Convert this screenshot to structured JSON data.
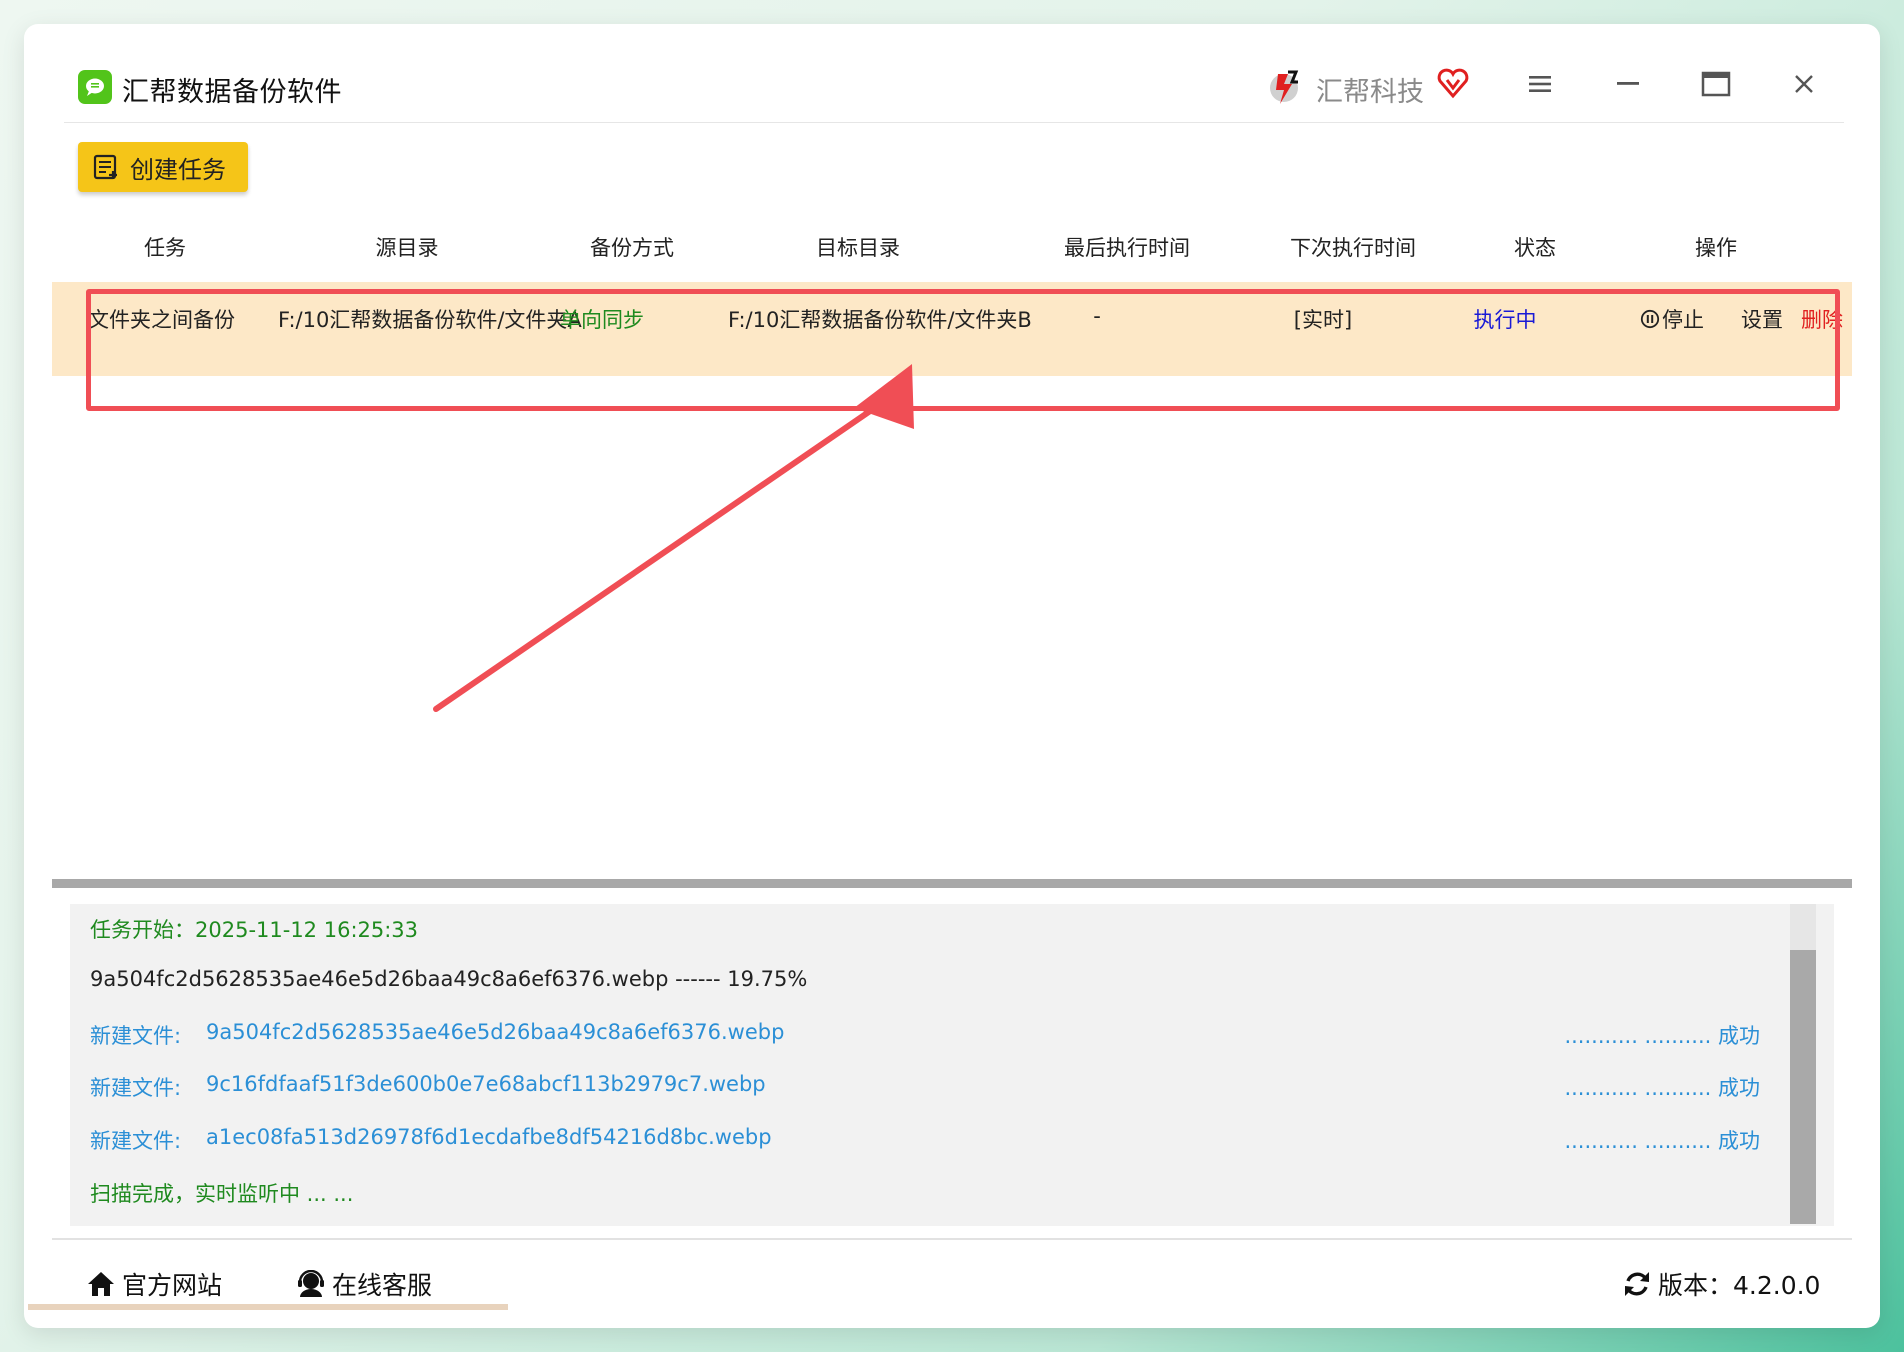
{
  "app": {
    "title": "汇帮数据备份软件",
    "brand_name": "汇帮科技",
    "icons": [
      "chat-app-icon",
      "brand-logo-icon",
      "vip-heart-icon",
      "menu-icon",
      "minimize-icon",
      "maximize-icon",
      "close-icon"
    ]
  },
  "toolbar": {
    "create_task_label": "创建任务"
  },
  "table": {
    "headers": [
      "任务",
      "源目录",
      "备份方式",
      "目标目录",
      "最后执行时间",
      "下次执行时间",
      "状态",
      "操作"
    ],
    "rows": [
      {
        "task": "文件夹之间备份",
        "source": "F:/10汇帮数据备份软件/文件夹A",
        "method": "单向同步",
        "target": "F:/10汇帮数据备份软件/文件夹B",
        "last_run": "-",
        "next_run": "[实时]",
        "status": "执行中",
        "actions": {
          "stop": "停止",
          "settings": "设置",
          "delete": "删除"
        }
      }
    ]
  },
  "log": {
    "start": "任务开始：2025-11-12 16:25:33",
    "progress": "9a504fc2d5628535ae46e5d26baa49c8a6ef6376.webp ------ 19.75%",
    "entries": [
      {
        "prefix": "新建文件:",
        "file": "9a504fc2d5628535ae46e5d26baa49c8a6ef6376.webp",
        "result": "........... .......... 成功"
      },
      {
        "prefix": "新建文件:",
        "file": "9c16fdfaaf51f3de600b0e7e68abcf113b2979c7.webp",
        "result": "........... .......... 成功"
      },
      {
        "prefix": "新建文件:",
        "file": "a1ec08fa513d26978f6d1ecdafbe8df54216d8bc.webp",
        "result": "........... .......... 成功"
      }
    ],
    "end": "扫描完成，实时监听中 ... ..."
  },
  "footer": {
    "website": "官方网站",
    "support": "在线客服",
    "version": "版本：4.2.0.0"
  },
  "colors": {
    "accent_yellow": "#f5c518",
    "row_highlight": "#fde8c7",
    "annotation_red": "#f04e55",
    "method_green": "#1f8a1f",
    "status_blue": "#1a1ad6",
    "delete_red": "#e02020",
    "log_blue": "#2b8fd6"
  }
}
